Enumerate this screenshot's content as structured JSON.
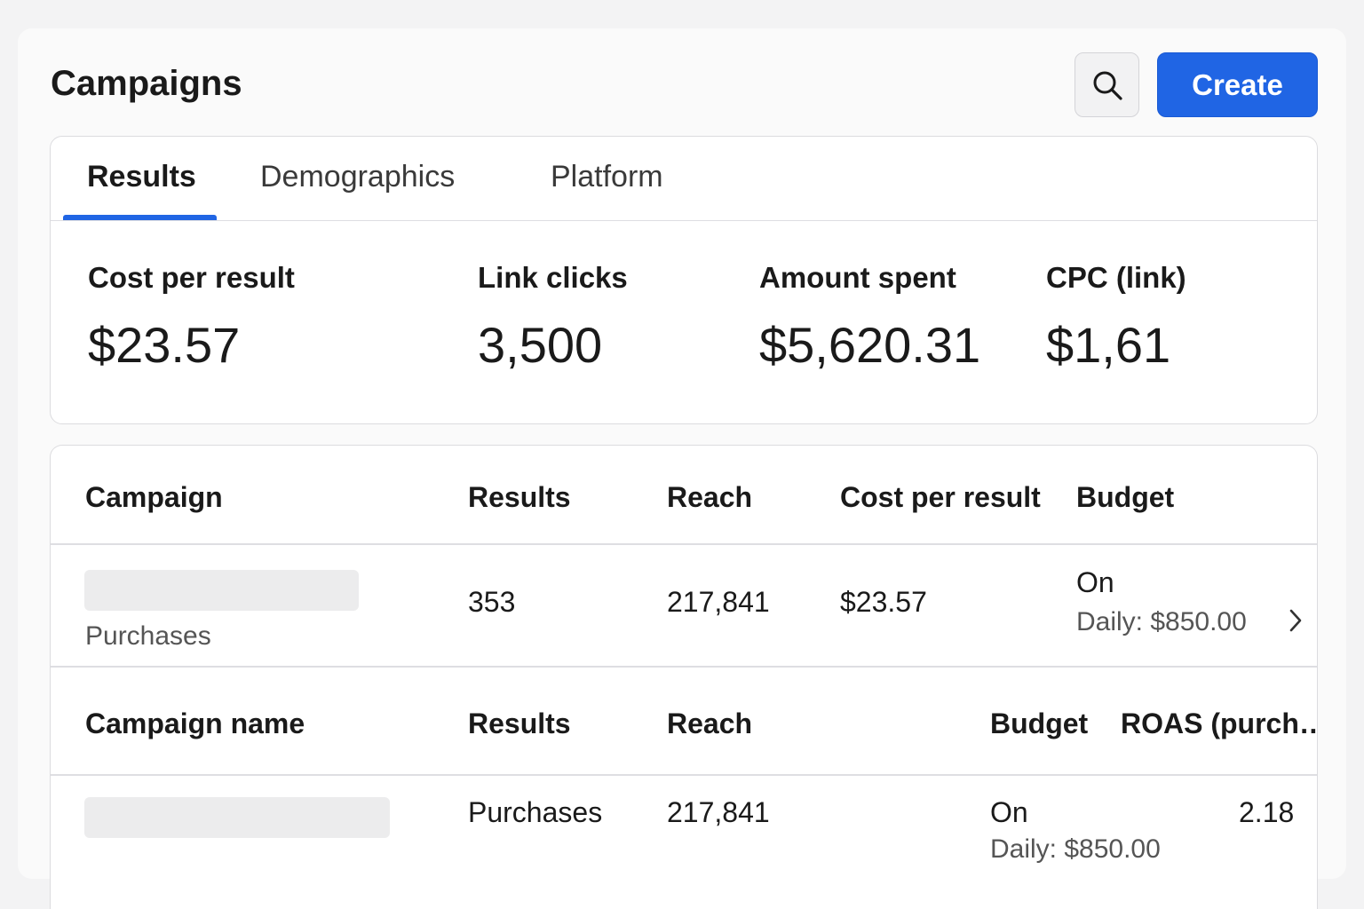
{
  "header": {
    "title": "Campaigns",
    "search_icon": "search-icon",
    "create_label": "Create",
    "accent_color": "#2065e4"
  },
  "tabs": [
    {
      "label": "Results",
      "active": true
    },
    {
      "label": "Demographics",
      "active": false
    },
    {
      "label": "Platform",
      "active": false
    }
  ],
  "summary": [
    {
      "label": "Cost per result",
      "value": "$23.57"
    },
    {
      "label": "Link clicks",
      "value": "3,500"
    },
    {
      "label": "Amount spent",
      "value": "$5,620.31"
    },
    {
      "label": "CPC (link)",
      "value": "$1,61"
    }
  ],
  "table1": {
    "headers": [
      "Campaign",
      "Results",
      "Reach",
      "Cost per result",
      "Budget"
    ],
    "row": {
      "subtitle": "Purchases",
      "results": "353",
      "reach": "217,841",
      "cost_per_result": "$23.57",
      "budget_status": "On",
      "budget_daily": "Daily: $850.00",
      "chevron_icon": "chevron-right-icon"
    }
  },
  "table2": {
    "headers": [
      "Campaign name",
      "Results",
      "Reach",
      "Budget",
      "ROAS (purch…"
    ],
    "row": {
      "results": "Purchases",
      "reach": "217,841",
      "budget_status": "On",
      "budget_daily": "Daily: $850.00",
      "roas": "2.18"
    }
  }
}
